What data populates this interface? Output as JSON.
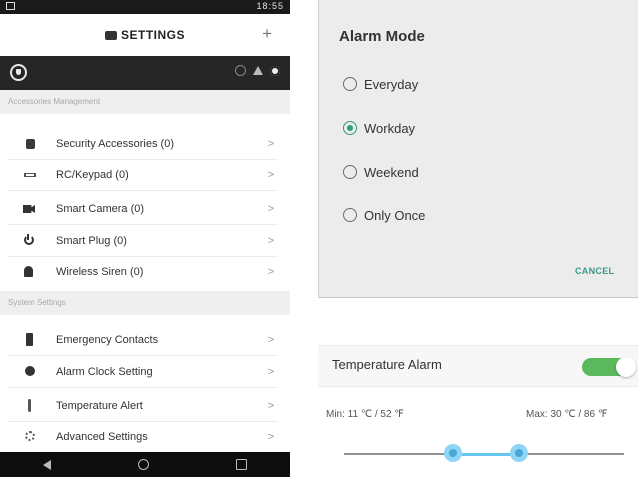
{
  "status_bar": {
    "time": "18:55",
    "icons": [
      "signal-icon",
      "wifi-icon",
      "battery-icon"
    ]
  },
  "title_bar": {
    "title": "SETTINGS",
    "add_symbol": "+"
  },
  "sections": [
    {
      "header": "Accessories Management",
      "items": [
        {
          "label": "Security Accessories (0)",
          "icon": "shield-icon"
        },
        {
          "label": "RC/Keypad (0)",
          "icon": "remote-icon"
        },
        {
          "label": "Smart Camera (0)",
          "icon": "camera-icon"
        },
        {
          "label": "Smart Plug (0)",
          "icon": "power-icon"
        },
        {
          "label": "Wireless Siren (0)",
          "icon": "siren-icon"
        }
      ]
    },
    {
      "header": "System Settings",
      "items": [
        {
          "label": "Emergency Contacts",
          "icon": "contact-icon"
        },
        {
          "label": "Alarm Clock Setting",
          "icon": "clock-icon"
        },
        {
          "label": "Temperature Alert",
          "icon": "thermometer-icon"
        },
        {
          "label": "Advanced Settings",
          "icon": "settings-icon"
        }
      ]
    }
  ],
  "dialog": {
    "title": "Alarm Mode",
    "options": [
      "Everyday",
      "Workday",
      "Weekend",
      "Only Once"
    ],
    "selected": "Workday",
    "cancel_label": "CANCEL"
  },
  "temperature": {
    "label": "Temperature Alarm",
    "enabled": true,
    "min_label": "Min: 11 ℃ /  52 ℉",
    "max_label": "Max: 30 ℃ /  86 ℉"
  },
  "colors": {
    "accent": "#2e9e74",
    "toggle": "#5cb85c",
    "slider": "#66c6ef",
    "cancel": "#3a9a86"
  }
}
